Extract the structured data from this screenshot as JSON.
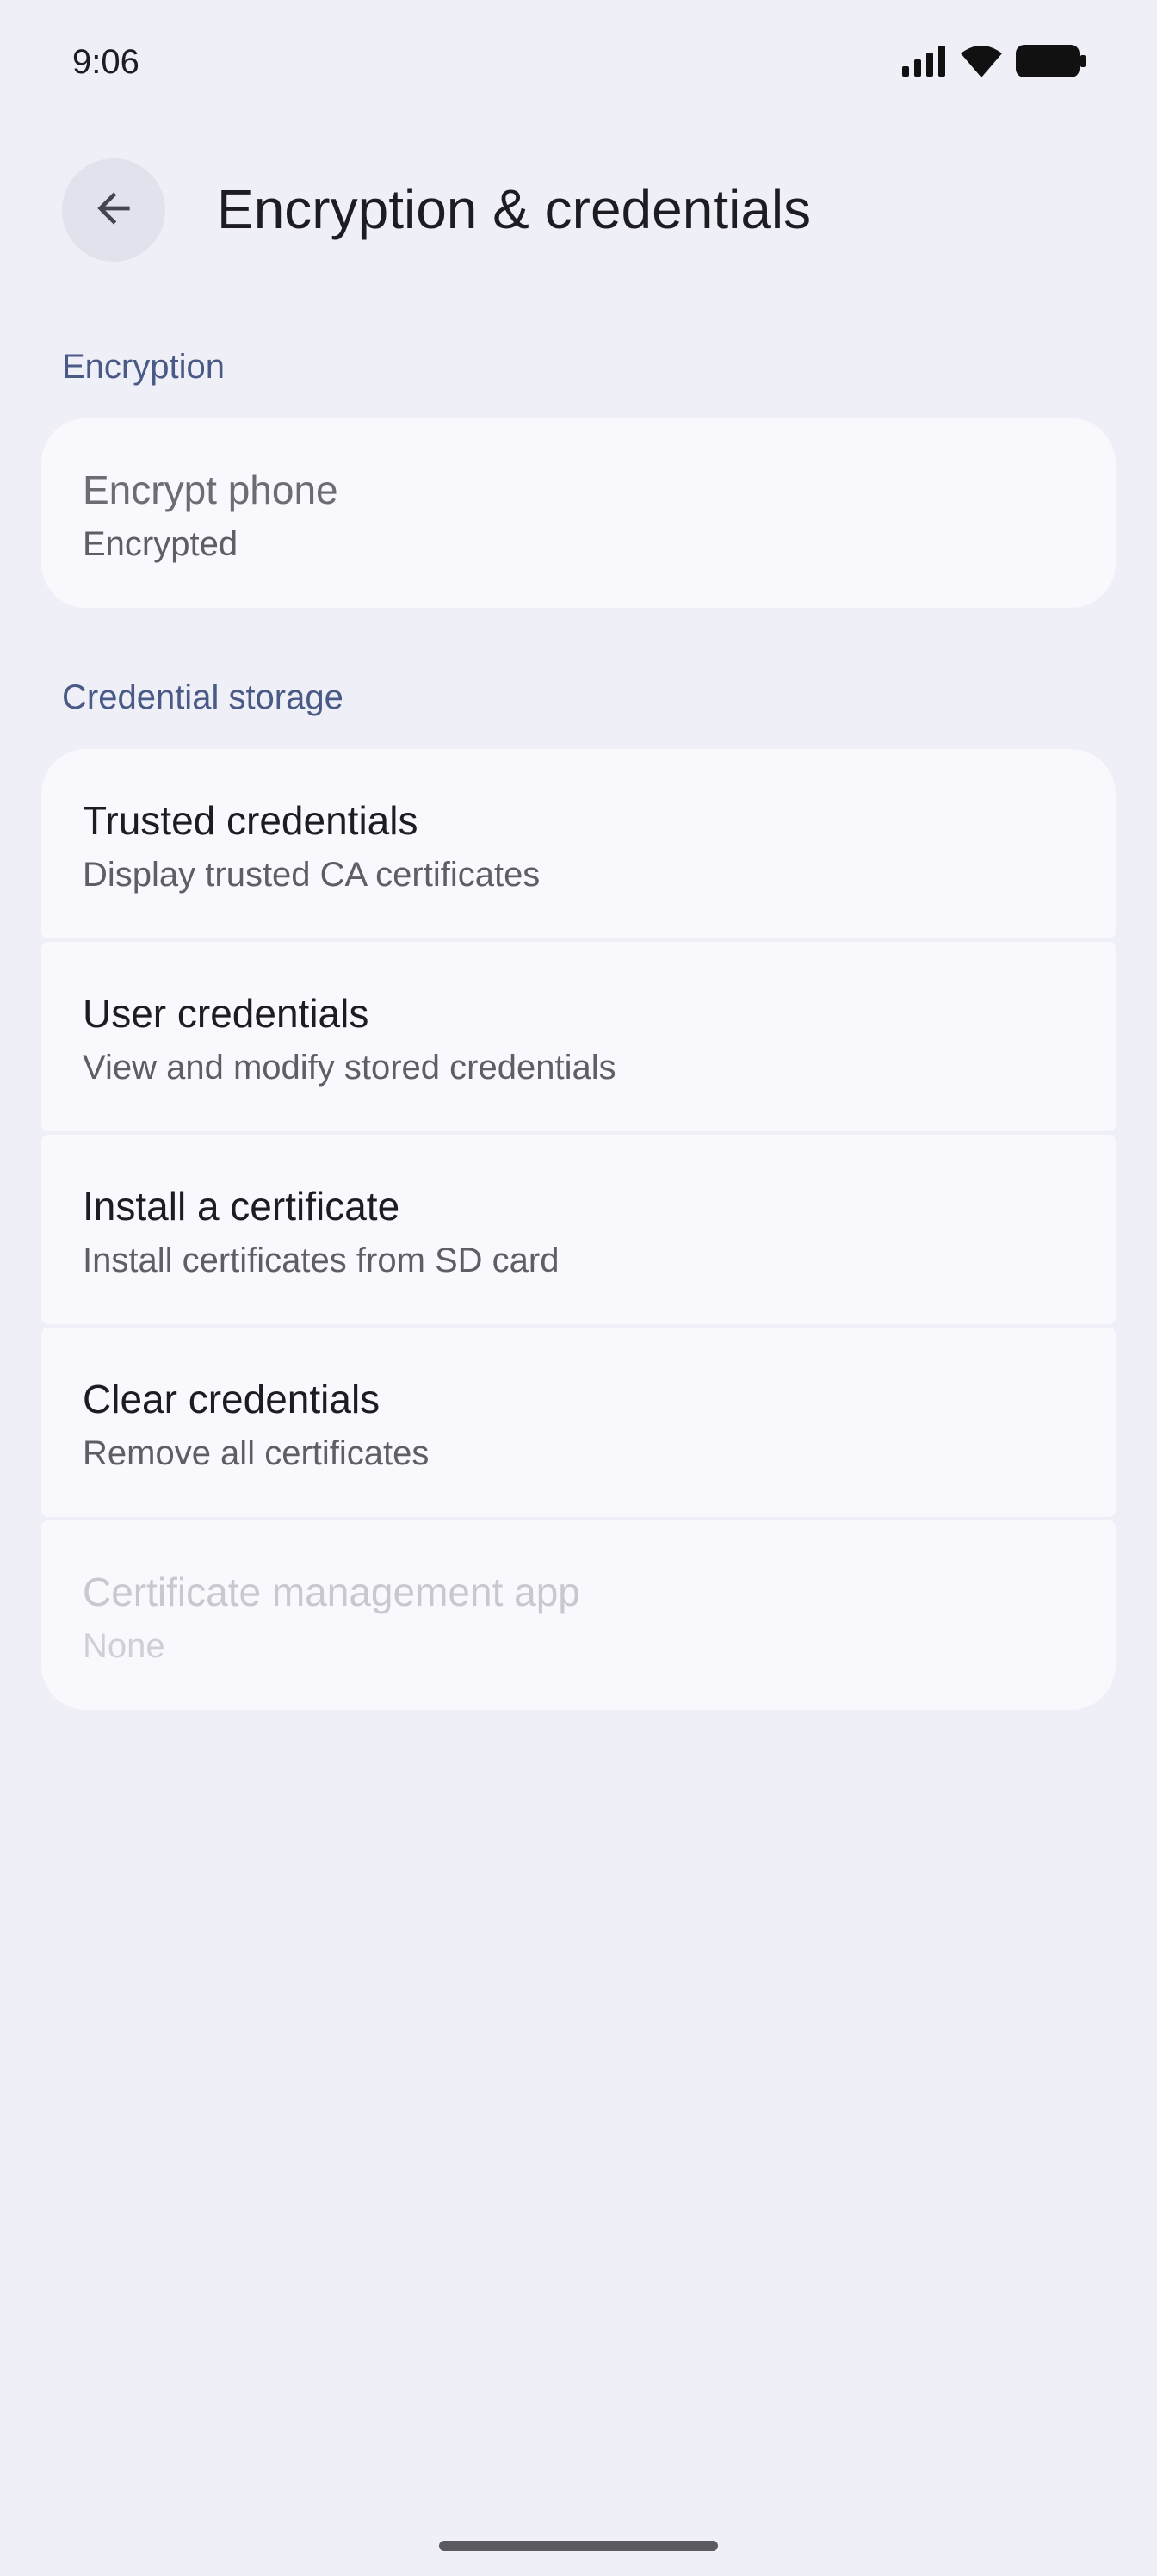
{
  "status_bar": {
    "time": "9:06",
    "icons": [
      "signal-icon",
      "wifi-icon",
      "battery-icon"
    ]
  },
  "app_bar": {
    "back_icon": "arrow-back-icon",
    "title": "Encryption & credentials"
  },
  "sections": [
    {
      "header": "Encryption",
      "items": [
        {
          "title": "Encrypt phone",
          "subtitle": "Encrypted"
        }
      ]
    },
    {
      "header": "Credential storage",
      "items": [
        {
          "title": "Trusted credentials",
          "subtitle": "Display trusted CA certificates"
        },
        {
          "title": "User credentials",
          "subtitle": "View and modify stored credentials"
        },
        {
          "title": "Install a certificate",
          "subtitle": "Install certificates from SD card"
        },
        {
          "title": "Clear credentials",
          "subtitle": "Remove all certificates"
        },
        {
          "title": "Certificate management app",
          "subtitle": "None"
        }
      ]
    }
  ],
  "colors": {
    "background": "#efeff8",
    "card": "#f8f8fd",
    "section_header": "#4a5a86",
    "disabled_text": "#c8c8cf"
  }
}
